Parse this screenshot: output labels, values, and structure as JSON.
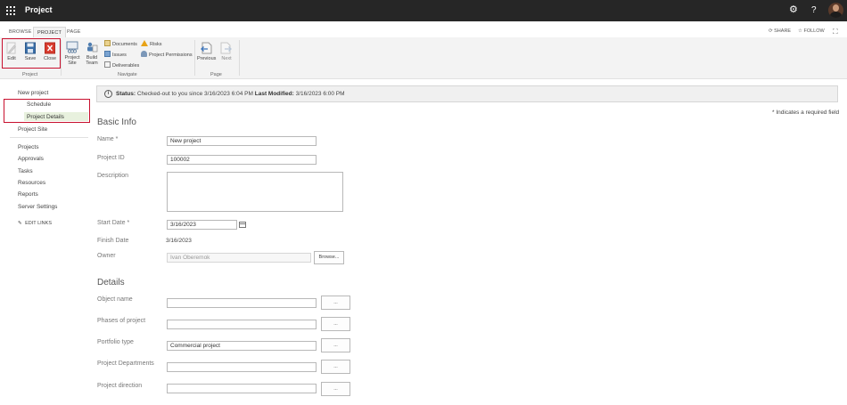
{
  "suite": {
    "title": "Project",
    "icons": [
      "app-launcher-icon",
      "gear-icon",
      "help-icon",
      "avatar"
    ]
  },
  "tabs": [
    {
      "label": "BROWSE",
      "active": false
    },
    {
      "label": "PROJECT",
      "active": true
    },
    {
      "label": "PAGE",
      "active": false
    }
  ],
  "top_actions": {
    "share": "SHARE",
    "follow": "FOLLOW"
  },
  "ribbon": {
    "project_group": {
      "label": "Project",
      "edit": "Edit",
      "save": "Save",
      "close": "Close"
    },
    "navigate_group": {
      "label": "Navigate",
      "project_site": "Project Site",
      "build_team": "Build Team",
      "documents": "Documents",
      "issues": "Issues",
      "deliverables": "Deliverables",
      "risks": "Risks",
      "project_permissions": "Project Permissions"
    },
    "page_group": {
      "label": "Page",
      "previous": "Previous",
      "next": "Next"
    }
  },
  "nav": {
    "new_project": "New project",
    "schedule": "Schedule",
    "project_details": "Project Details",
    "project_site": "Project Site",
    "projects": "Projects",
    "approvals": "Approvals",
    "tasks": "Tasks",
    "resources": "Resources",
    "reports": "Reports",
    "server_settings": "Server Settings",
    "edit_links": "EDIT LINKS"
  },
  "status": {
    "status_label": "Status:",
    "status_value": "Checked-out to you since 3/16/2023 6:04 PM",
    "modified_label": "Last Modified:",
    "modified_value": "3/16/2023 6:00 PM"
  },
  "required_note": "* Indicates a required field",
  "basic_info": {
    "heading": "Basic Info",
    "name_label": "Name *",
    "name_value": "New project",
    "project_id_label": "Project ID",
    "project_id_value": "100002",
    "description_label": "Description",
    "description_value": "",
    "start_date_label": "Start Date *",
    "start_date_value": "3/16/2023",
    "finish_date_label": "Finish Date",
    "finish_date_value": "3/16/2023",
    "owner_label": "Owner",
    "owner_value": "Ivan Oberemok",
    "browse_label": "Browse..."
  },
  "details": {
    "heading": "Details",
    "object_name_label": "Object name",
    "object_name_value": "",
    "phases_label": "Phases of project",
    "phases_value": "",
    "portfolio_type_label": "Portfolio type",
    "portfolio_type_value": "Commercial project",
    "departments_label": "Project Departments",
    "departments_value": "",
    "direction_label": "Project direction",
    "direction_value": "",
    "picker_label": "..."
  },
  "colors": {
    "suitebar": "#262626",
    "highlight_frame": "#c8102e",
    "nav_selected_bg": "#e8f1de"
  }
}
